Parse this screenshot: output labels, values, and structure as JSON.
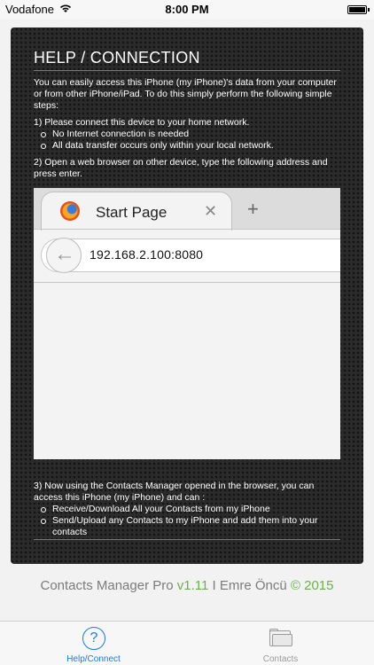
{
  "status": {
    "carrier": "Vodafone",
    "time": "8:00 PM"
  },
  "help": {
    "title": "HELP / CONNECTION",
    "intro": "You can easily access this iPhone (my iPhone)'s data from your computer or from other iPhone/iPad. To do this simply perform the following simple steps:",
    "step1": {
      "text": "1) Please connect this device to your home network.",
      "bullets": [
        "No Internet connection is needed",
        "All data transfer occurs only within your local network."
      ]
    },
    "step2": {
      "text": "2) Open a web browser on other device, type the following address and press enter."
    },
    "step3": {
      "text": "3) Now using the Contacts Manager opened in the browser, you can access this iPhone (my iPhone) and can :",
      "bullets": [
        "Receive/Download All your Contacts from my iPhone",
        "Send/Upload any Contacts to my iPhone and add them into your contacts"
      ]
    }
  },
  "browser": {
    "tab_title": "Start Page",
    "close_glyph": "✕",
    "new_tab_glyph": "+",
    "back_glyph": "←",
    "url": "192.168.2.100:8080"
  },
  "footer": {
    "app_name": "Contacts Manager Pro",
    "version": "v1.11",
    "separator": "I",
    "author": "Emre Öncü",
    "copyright": "© 2015"
  },
  "tabbar": {
    "items": [
      {
        "label": "Help/Connect",
        "icon": "help-icon",
        "active": true
      },
      {
        "label": "Contacts",
        "icon": "folder-icon",
        "active": false
      }
    ]
  },
  "colors": {
    "accent": "#1a7be0",
    "footer_green": "#6ab04c",
    "panel_bg": "#2b2b2b"
  }
}
